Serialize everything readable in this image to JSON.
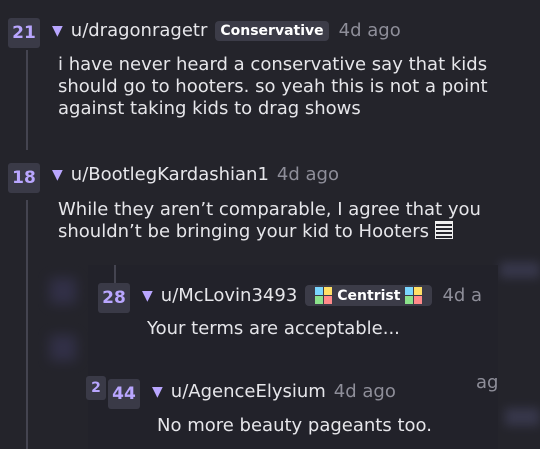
{
  "comments": [
    {
      "votes": "21",
      "username": "u/dragonragetr",
      "flair": "Conservative",
      "age": "4d ago",
      "body_lines": [
        "i have never heard a conservative say that kids",
        "should go to hooters. so yeah this is not a point",
        "against taking kids to drag shows"
      ]
    },
    {
      "votes": "18",
      "username": "u/BootlegKardashian1",
      "age": "4d ago",
      "body_lines": [
        "While they aren’t comparable, I agree that you",
        "shouldn’t be bringing your kid to Hooters"
      ],
      "emoji_icon": "book-icon"
    },
    {
      "votes": "28",
      "username": "u/McLovin3493",
      "flair": "Centrist",
      "flair_icon": "four-square-tile-icon",
      "age": "4d a",
      "body_lines": [
        "Your terms are acceptable..."
      ]
    },
    {
      "votes": "44",
      "partial_vote_behind": "2",
      "username": "u/AgenceElysium",
      "age": "4d ago",
      "body_lines": [
        "No more beauty pageants too."
      ],
      "peek_text": "ag"
    }
  ],
  "colors": {
    "accent": "#b9a6ff",
    "background": "#24242b",
    "tile_colors": [
      "#7ad7ff",
      "#ffe066",
      "#8be28b",
      "#ff8a8a"
    ]
  }
}
